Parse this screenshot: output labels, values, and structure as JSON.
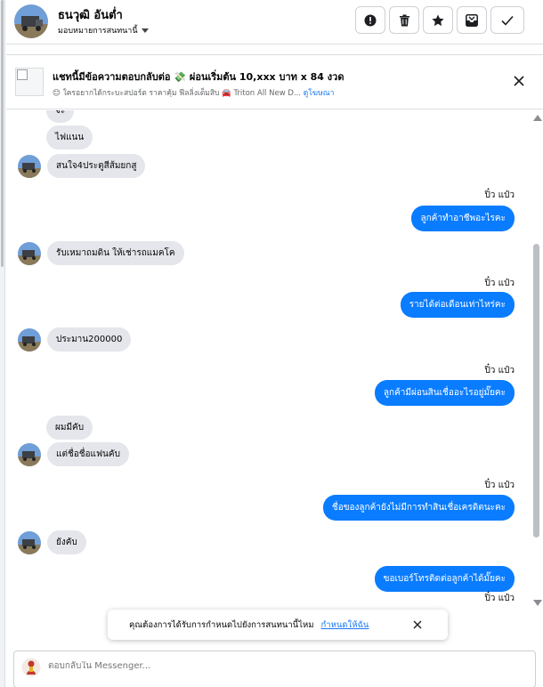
{
  "header": {
    "name": "ธนวุฒิ อันต่ำ",
    "subtitle": "มอบหมายการสนทนานี้",
    "actions": [
      "alert-icon",
      "trash-icon",
      "star-icon",
      "mail-icon",
      "check-icon"
    ]
  },
  "banner": {
    "title": "แชทนี้มีข้อความตอบกลับต่อ 💸 ผ่อนเริ่มต้น 10,xxx บาท x 84 งวด",
    "subtitle": "😊 ใครอยากได้กระบะสปอร์ต ราคาคุ้ม ฟีลลิ่งเต็มสิบ 🚘 Triton All New D...",
    "link": "ดูโฆษณา"
  },
  "messages": [
    {
      "dir": "in",
      "text": "จ้ะ",
      "avatar": false
    },
    {
      "dir": "in",
      "text": "ไฟแนน",
      "avatar": false
    },
    {
      "dir": "in",
      "text": "สนใจ4ประตูสีส้มยกสู",
      "avatar": true
    },
    {
      "dir": "out",
      "sender": "ปิ๋ว แป๋ว",
      "text": "ลูกค้าทำอาชีพอะไรคะ"
    },
    {
      "dir": "in",
      "text": "รับเหมาถมดิน ให้เช่ารถแมคโค",
      "avatar": true
    },
    {
      "dir": "out",
      "sender": "ปิ๋ว แป๋ว",
      "text": "รายได้ต่อเดือนเท่าไหร่คะ"
    },
    {
      "dir": "in",
      "text": "ประมาน200000",
      "avatar": true
    },
    {
      "dir": "out",
      "sender": "ปิ๋ว แป๋ว",
      "text": "ลูกค้ามีผ่อนสินเชื่ออะไรอยู่มั๊ยคะ"
    },
    {
      "dir": "in",
      "text": "ผมมีคับ",
      "avatar": false
    },
    {
      "dir": "in",
      "text": "แต่ชื่อชื่อแฟนคับ",
      "avatar": true
    },
    {
      "dir": "out",
      "sender": "ปิ๋ว แป๋ว",
      "text": "ชื่อของลูกค้ายังไม่มีการทำสินเชื่อเครดิตนะคะ"
    },
    {
      "dir": "in",
      "text": "ยังคับ",
      "avatar": true
    },
    {
      "dir": "out",
      "sender": "",
      "text": "ขอเบอร์โทรติดต่อลูกค้าได้มั๊ยคะ"
    },
    {
      "dir": "out",
      "sender": "ปิ๋ว แป๋ว",
      "text": ""
    }
  ],
  "toast": {
    "question": "คุณต้องการได้รับการกำหนดไปยังการสนทนานี้ไหม",
    "action": "กำหนดให้ฉัน"
  },
  "composer": {
    "placeholder": "ตอบกลับใน Messenger..."
  },
  "colors": {
    "outgoing_bubble": "#0a7cff",
    "incoming_bubble": "#e4e6eb",
    "link": "#1877f2"
  }
}
